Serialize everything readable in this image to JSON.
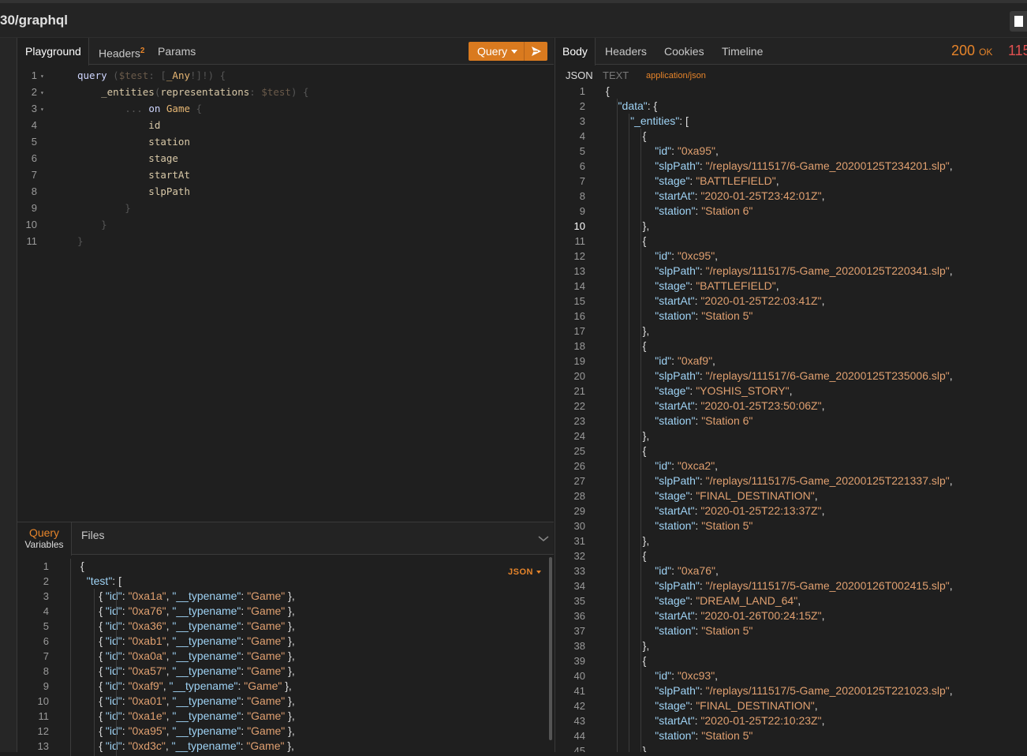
{
  "url": {
    "text": "30/graphql"
  },
  "left": {
    "tabs": [
      "Playground",
      "Headers",
      "Params"
    ],
    "headers_count": "2",
    "query_button": "Query",
    "query_lines": [
      [
        [
          "kw",
          "query "
        ],
        [
          "dim",
          "("
        ],
        [
          "var",
          "$test"
        ],
        [
          "dim",
          ": ["
        ],
        [
          "typ",
          "_Any"
        ],
        [
          "dim",
          "!]!) {"
        ]
      ],
      [
        [
          "fld",
          "    _entities"
        ],
        [
          "dim",
          "("
        ],
        [
          "fld",
          "representations"
        ],
        [
          "dim",
          ": "
        ],
        [
          "var",
          "$test"
        ],
        [
          "dim",
          ") {"
        ]
      ],
      [
        [
          "dim",
          "        ... "
        ],
        [
          "kw",
          "on "
        ],
        [
          "typ",
          "Game "
        ],
        [
          "dim",
          "{"
        ]
      ],
      [
        [
          "fld",
          "            id"
        ]
      ],
      [
        [
          "fld",
          "            station"
        ]
      ],
      [
        [
          "fld",
          "            stage"
        ]
      ],
      [
        [
          "fld",
          "            startAt"
        ]
      ],
      [
        [
          "fld",
          "            slpPath"
        ]
      ],
      [
        [
          "dim",
          "        }"
        ]
      ],
      [
        [
          "dim",
          "    }"
        ]
      ],
      [
        [
          "dim",
          "}"
        ]
      ]
    ],
    "fold_lines": [
      1,
      2,
      3
    ],
    "variables": {
      "tab_label_1": "Query",
      "tab_label_2": "Variables",
      "files_label": "Files",
      "format_badge": "JSON",
      "lines": [
        [
          [
            "p",
            "{"
          ]
        ],
        [
          [
            "k",
            "  \"test\""
          ],
          [
            "p",
            ": ["
          ]
        ],
        [
          [
            "p",
            "      { "
          ],
          [
            "k",
            "\"id\""
          ],
          [
            "p",
            ": "
          ],
          [
            "s",
            "\"0xa1a\""
          ],
          [
            "p",
            ", "
          ],
          [
            "k",
            "\"__typename\""
          ],
          [
            "p",
            ": "
          ],
          [
            "s",
            "\"Game\""
          ],
          [
            "p",
            " },"
          ]
        ],
        [
          [
            "p",
            "      { "
          ],
          [
            "k",
            "\"id\""
          ],
          [
            "p",
            ": "
          ],
          [
            "s",
            "\"0xa76\""
          ],
          [
            "p",
            ", "
          ],
          [
            "k",
            "\"__typename\""
          ],
          [
            "p",
            ": "
          ],
          [
            "s",
            "\"Game\""
          ],
          [
            "p",
            " },"
          ]
        ],
        [
          [
            "p",
            "      { "
          ],
          [
            "k",
            "\"id\""
          ],
          [
            "p",
            ": "
          ],
          [
            "s",
            "\"0xa36\""
          ],
          [
            "p",
            ", "
          ],
          [
            "k",
            "\"__typename\""
          ],
          [
            "p",
            ": "
          ],
          [
            "s",
            "\"Game\""
          ],
          [
            "p",
            " },"
          ]
        ],
        [
          [
            "p",
            "      { "
          ],
          [
            "k",
            "\"id\""
          ],
          [
            "p",
            ": "
          ],
          [
            "s",
            "\"0xab1\""
          ],
          [
            "p",
            ", "
          ],
          [
            "k",
            "\"__typename\""
          ],
          [
            "p",
            ": "
          ],
          [
            "s",
            "\"Game\""
          ],
          [
            "p",
            " },"
          ]
        ],
        [
          [
            "p",
            "      { "
          ],
          [
            "k",
            "\"id\""
          ],
          [
            "p",
            ": "
          ],
          [
            "s",
            "\"0xa0a\""
          ],
          [
            "p",
            ", "
          ],
          [
            "k",
            "\"__typename\""
          ],
          [
            "p",
            ": "
          ],
          [
            "s",
            "\"Game\""
          ],
          [
            "p",
            " },"
          ]
        ],
        [
          [
            "p",
            "      { "
          ],
          [
            "k",
            "\"id\""
          ],
          [
            "p",
            ": "
          ],
          [
            "s",
            "\"0xa57\""
          ],
          [
            "p",
            ", "
          ],
          [
            "k",
            "\"__typename\""
          ],
          [
            "p",
            ": "
          ],
          [
            "s",
            "\"Game\""
          ],
          [
            "p",
            " },"
          ]
        ],
        [
          [
            "p",
            "      { "
          ],
          [
            "k",
            "\"id\""
          ],
          [
            "p",
            ": "
          ],
          [
            "s",
            "\"0xaf9\""
          ],
          [
            "p",
            ", "
          ],
          [
            "k",
            "\"__typename\""
          ],
          [
            "p",
            ": "
          ],
          [
            "s",
            "\"Game\""
          ],
          [
            "p",
            " },"
          ]
        ],
        [
          [
            "p",
            "      { "
          ],
          [
            "k",
            "\"id\""
          ],
          [
            "p",
            ": "
          ],
          [
            "s",
            "\"0xa01\""
          ],
          [
            "p",
            ", "
          ],
          [
            "k",
            "\"__typename\""
          ],
          [
            "p",
            ": "
          ],
          [
            "s",
            "\"Game\""
          ],
          [
            "p",
            " },"
          ]
        ],
        [
          [
            "p",
            "      { "
          ],
          [
            "k",
            "\"id\""
          ],
          [
            "p",
            ": "
          ],
          [
            "s",
            "\"0xa1e\""
          ],
          [
            "p",
            ", "
          ],
          [
            "k",
            "\"__typename\""
          ],
          [
            "p",
            ": "
          ],
          [
            "s",
            "\"Game\""
          ],
          [
            "p",
            " },"
          ]
        ],
        [
          [
            "p",
            "      { "
          ],
          [
            "k",
            "\"id\""
          ],
          [
            "p",
            ": "
          ],
          [
            "s",
            "\"0xa95\""
          ],
          [
            "p",
            ", "
          ],
          [
            "k",
            "\"__typename\""
          ],
          [
            "p",
            ": "
          ],
          [
            "s",
            "\"Game\""
          ],
          [
            "p",
            " },"
          ]
        ],
        [
          [
            "p",
            "      { "
          ],
          [
            "k",
            "\"id\""
          ],
          [
            "p",
            ": "
          ],
          [
            "s",
            "\"0xd3c\""
          ],
          [
            "p",
            ", "
          ],
          [
            "k",
            "\"__typename\""
          ],
          [
            "p",
            ": "
          ],
          [
            "s",
            "\"Game\""
          ],
          [
            "p",
            " },"
          ]
        ]
      ]
    }
  },
  "right": {
    "tabs": [
      "Body",
      "Headers",
      "Cookies",
      "Timeline"
    ],
    "status_code": "200",
    "status_text": "OK",
    "time_partial": "115",
    "subtabs": [
      "JSON",
      "TEXT",
      "application/json"
    ],
    "current_line": 10,
    "lines": [
      [
        [
          "p",
          "{"
        ]
      ],
      [
        [
          "k",
          "    \"data\""
        ],
        [
          "p",
          ": {"
        ]
      ],
      [
        [
          "k",
          "        \"_entities\""
        ],
        [
          "p",
          ": ["
        ]
      ],
      [
        [
          "p",
          "            {"
        ]
      ],
      [
        [
          "k",
          "                \"id\""
        ],
        [
          "p",
          ": "
        ],
        [
          "s",
          "\"0xa95\""
        ],
        [
          "p",
          ","
        ]
      ],
      [
        [
          "k",
          "                \"slpPath\""
        ],
        [
          "p",
          ": "
        ],
        [
          "s",
          "\"/replays/111517/6-Game_20200125T234201.slp\""
        ],
        [
          "p",
          ","
        ]
      ],
      [
        [
          "k",
          "                \"stage\""
        ],
        [
          "p",
          ": "
        ],
        [
          "s",
          "\"BATTLEFIELD\""
        ],
        [
          "p",
          ","
        ]
      ],
      [
        [
          "k",
          "                \"startAt\""
        ],
        [
          "p",
          ": "
        ],
        [
          "s",
          "\"2020-01-25T23:42:01Z\""
        ],
        [
          "p",
          ","
        ]
      ],
      [
        [
          "k",
          "                \"station\""
        ],
        [
          "p",
          ": "
        ],
        [
          "s",
          "\"Station 6\""
        ]
      ],
      [
        [
          "p",
          "            },"
        ]
      ],
      [
        [
          "p",
          "            {"
        ]
      ],
      [
        [
          "k",
          "                \"id\""
        ],
        [
          "p",
          ": "
        ],
        [
          "s",
          "\"0xc95\""
        ],
        [
          "p",
          ","
        ]
      ],
      [
        [
          "k",
          "                \"slpPath\""
        ],
        [
          "p",
          ": "
        ],
        [
          "s",
          "\"/replays/111517/5-Game_20200125T220341.slp\""
        ],
        [
          "p",
          ","
        ]
      ],
      [
        [
          "k",
          "                \"stage\""
        ],
        [
          "p",
          ": "
        ],
        [
          "s",
          "\"BATTLEFIELD\""
        ],
        [
          "p",
          ","
        ]
      ],
      [
        [
          "k",
          "                \"startAt\""
        ],
        [
          "p",
          ": "
        ],
        [
          "s",
          "\"2020-01-25T22:03:41Z\""
        ],
        [
          "p",
          ","
        ]
      ],
      [
        [
          "k",
          "                \"station\""
        ],
        [
          "p",
          ": "
        ],
        [
          "s",
          "\"Station 5\""
        ]
      ],
      [
        [
          "p",
          "            },"
        ]
      ],
      [
        [
          "p",
          "            {"
        ]
      ],
      [
        [
          "k",
          "                \"id\""
        ],
        [
          "p",
          ": "
        ],
        [
          "s",
          "\"0xaf9\""
        ],
        [
          "p",
          ","
        ]
      ],
      [
        [
          "k",
          "                \"slpPath\""
        ],
        [
          "p",
          ": "
        ],
        [
          "s",
          "\"/replays/111517/6-Game_20200125T235006.slp\""
        ],
        [
          "p",
          ","
        ]
      ],
      [
        [
          "k",
          "                \"stage\""
        ],
        [
          "p",
          ": "
        ],
        [
          "s",
          "\"YOSHIS_STORY\""
        ],
        [
          "p",
          ","
        ]
      ],
      [
        [
          "k",
          "                \"startAt\""
        ],
        [
          "p",
          ": "
        ],
        [
          "s",
          "\"2020-01-25T23:50:06Z\""
        ],
        [
          "p",
          ","
        ]
      ],
      [
        [
          "k",
          "                \"station\""
        ],
        [
          "p",
          ": "
        ],
        [
          "s",
          "\"Station 6\""
        ]
      ],
      [
        [
          "p",
          "            },"
        ]
      ],
      [
        [
          "p",
          "            {"
        ]
      ],
      [
        [
          "k",
          "                \"id\""
        ],
        [
          "p",
          ": "
        ],
        [
          "s",
          "\"0xca2\""
        ],
        [
          "p",
          ","
        ]
      ],
      [
        [
          "k",
          "                \"slpPath\""
        ],
        [
          "p",
          ": "
        ],
        [
          "s",
          "\"/replays/111517/5-Game_20200125T221337.slp\""
        ],
        [
          "p",
          ","
        ]
      ],
      [
        [
          "k",
          "                \"stage\""
        ],
        [
          "p",
          ": "
        ],
        [
          "s",
          "\"FINAL_DESTINATION\""
        ],
        [
          "p",
          ","
        ]
      ],
      [
        [
          "k",
          "                \"startAt\""
        ],
        [
          "p",
          ": "
        ],
        [
          "s",
          "\"2020-01-25T22:13:37Z\""
        ],
        [
          "p",
          ","
        ]
      ],
      [
        [
          "k",
          "                \"station\""
        ],
        [
          "p",
          ": "
        ],
        [
          "s",
          "\"Station 5\""
        ]
      ],
      [
        [
          "p",
          "            },"
        ]
      ],
      [
        [
          "p",
          "            {"
        ]
      ],
      [
        [
          "k",
          "                \"id\""
        ],
        [
          "p",
          ": "
        ],
        [
          "s",
          "\"0xa76\""
        ],
        [
          "p",
          ","
        ]
      ],
      [
        [
          "k",
          "                \"slpPath\""
        ],
        [
          "p",
          ": "
        ],
        [
          "s",
          "\"/replays/111517/5-Game_20200126T002415.slp\""
        ],
        [
          "p",
          ","
        ]
      ],
      [
        [
          "k",
          "                \"stage\""
        ],
        [
          "p",
          ": "
        ],
        [
          "s",
          "\"DREAM_LAND_64\""
        ],
        [
          "p",
          ","
        ]
      ],
      [
        [
          "k",
          "                \"startAt\""
        ],
        [
          "p",
          ": "
        ],
        [
          "s",
          "\"2020-01-26T00:24:15Z\""
        ],
        [
          "p",
          ","
        ]
      ],
      [
        [
          "k",
          "                \"station\""
        ],
        [
          "p",
          ": "
        ],
        [
          "s",
          "\"Station 5\""
        ]
      ],
      [
        [
          "p",
          "            },"
        ]
      ],
      [
        [
          "p",
          "            {"
        ]
      ],
      [
        [
          "k",
          "                \"id\""
        ],
        [
          "p",
          ": "
        ],
        [
          "s",
          "\"0xc93\""
        ],
        [
          "p",
          ","
        ]
      ],
      [
        [
          "k",
          "                \"slpPath\""
        ],
        [
          "p",
          ": "
        ],
        [
          "s",
          "\"/replays/111517/5-Game_20200125T221023.slp\""
        ],
        [
          "p",
          ","
        ]
      ],
      [
        [
          "k",
          "                \"stage\""
        ],
        [
          "p",
          ": "
        ],
        [
          "s",
          "\"FINAL_DESTINATION\""
        ],
        [
          "p",
          ","
        ]
      ],
      [
        [
          "k",
          "                \"startAt\""
        ],
        [
          "p",
          ": "
        ],
        [
          "s",
          "\"2020-01-25T22:10:23Z\""
        ],
        [
          "p",
          ","
        ]
      ],
      [
        [
          "k",
          "                \"station\""
        ],
        [
          "p",
          ": "
        ],
        [
          "s",
          "\"Station 5\""
        ]
      ],
      [
        [
          "p",
          "            },"
        ]
      ]
    ]
  }
}
